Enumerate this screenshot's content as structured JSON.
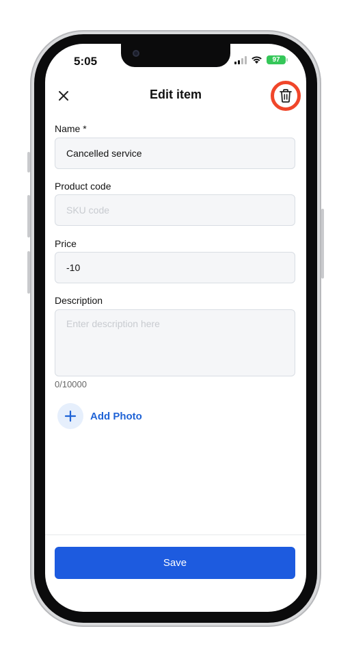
{
  "status_bar": {
    "time": "5:05",
    "battery": "97"
  },
  "nav": {
    "title": "Edit item",
    "close_icon": "close-icon",
    "delete_icon": "trash-icon",
    "highlight_color": "#f0462a"
  },
  "form": {
    "name": {
      "label": "Name *",
      "value": "Cancelled service"
    },
    "product_code": {
      "label": "Product code",
      "value": "",
      "placeholder": "SKU code"
    },
    "price": {
      "label": "Price",
      "value": "-10"
    },
    "description": {
      "label": "Description",
      "value": "",
      "placeholder": "Enter description here",
      "counter": "0/10000"
    }
  },
  "add_photo": {
    "label": "Add Photo",
    "icon": "plus-icon"
  },
  "save_button": {
    "label": "Save",
    "color": "#1d5bdf"
  }
}
